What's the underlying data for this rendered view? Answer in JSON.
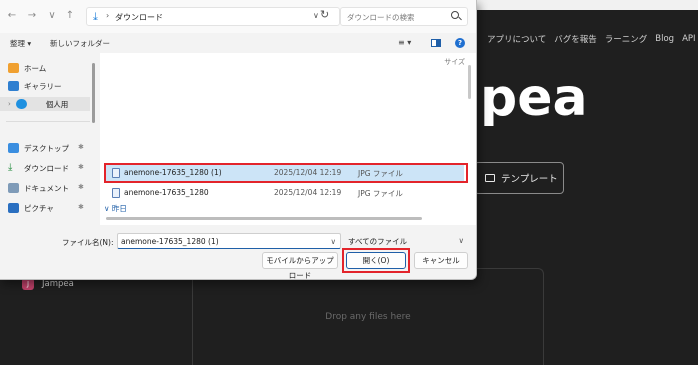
{
  "background": {
    "nav_items": [
      "アプリについて",
      "バグを報告",
      "ラーニング",
      "Blog",
      "API"
    ],
    "hero_text": "pea",
    "template_button": "テンプレート",
    "sidebar_app": {
      "icon_letter": "J",
      "label": "Jampea"
    },
    "dropzone_text": "Drop any files here"
  },
  "dialog": {
    "address": {
      "location": "ダウンロード"
    },
    "search": {
      "placeholder": "ダウンロードの検索"
    },
    "toolbar": {
      "organize": "整理 ▾",
      "new_folder": "新しいフォルダー"
    },
    "nav_pane": {
      "items": [
        {
          "label": "ホーム",
          "icon": "home-icon"
        },
        {
          "label": "ギャラリー",
          "icon": "gallery-icon"
        },
        {
          "label": "個人用",
          "icon": "onedrive-icon"
        },
        {
          "label": "デスクトップ",
          "icon": "desktop-icon"
        },
        {
          "label": "ダウンロード",
          "icon": "download-icon"
        },
        {
          "label": "ドキュメント",
          "icon": "documents-icon"
        },
        {
          "label": "ピクチャ",
          "icon": "pictures-icon"
        }
      ]
    },
    "file_list": {
      "size_header": "サイズ",
      "rows": [
        {
          "name": "anemone-17635_1280 (1)",
          "date": "2025/12/04 12:19",
          "type": "JPG ファイル"
        },
        {
          "name": "anemone-17635_1280",
          "date": "2025/12/04 12:19",
          "type": "JPG ファイル"
        }
      ],
      "group_yesterday": "∨ 昨日"
    },
    "filename_label": "ファイル名(N):",
    "filename_value": "anemone-17635_1280 (1)",
    "filter_value": "すべてのファイル",
    "buttons": {
      "mobile_upload": "モバイルからアップロード",
      "open": "開く(O)",
      "cancel": "キャンセル"
    }
  },
  "colors": {
    "highlight": "#e3242b",
    "selection": "#cce4f7",
    "accent": "#1f5fa8"
  }
}
